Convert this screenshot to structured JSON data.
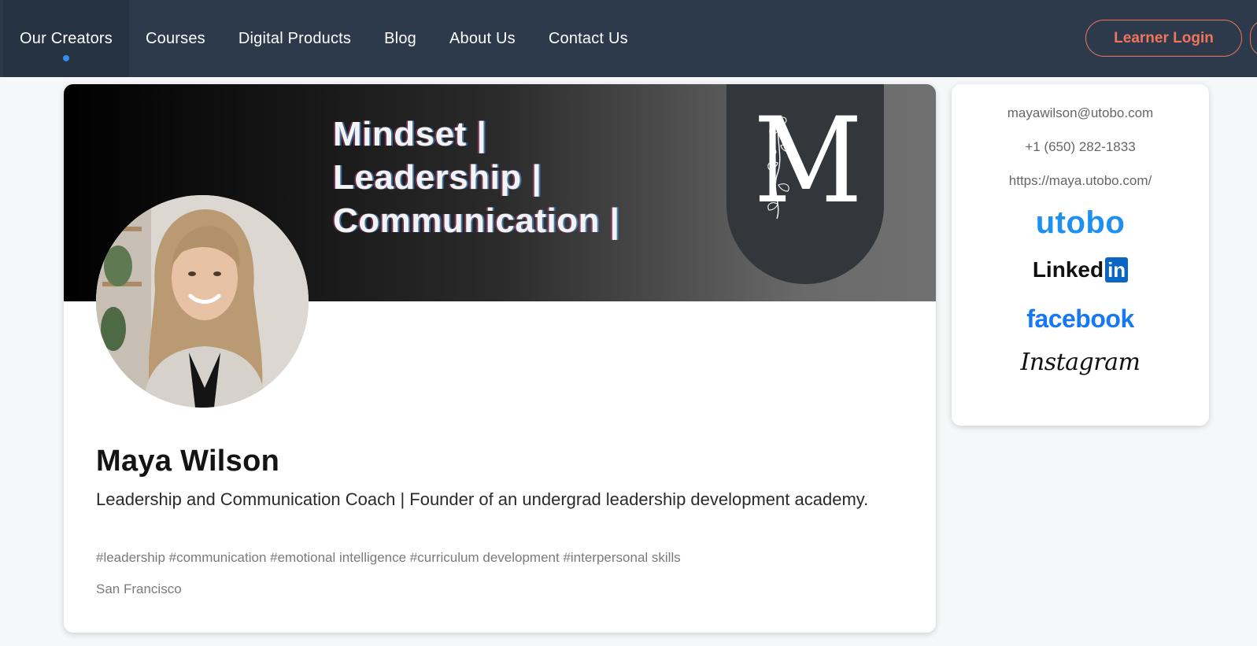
{
  "nav": {
    "items": [
      {
        "label": "Our Creators",
        "active": true
      },
      {
        "label": "Courses"
      },
      {
        "label": "Digital Products"
      },
      {
        "label": "Blog"
      },
      {
        "label": "About Us"
      },
      {
        "label": "Contact Us"
      }
    ],
    "login_label": "Learner Login"
  },
  "banner": {
    "lines": [
      "Mindset |",
      "Leadership |",
      "Communication |"
    ],
    "monogram": "M"
  },
  "profile": {
    "name": "Maya Wilson",
    "bio": "Leadership and Communication Coach | Founder of an undergrad leadership development academy.",
    "tags": "#leadership #communication #emotional intelligence #curriculum development #interpersonal skills",
    "location": "San Francisco"
  },
  "contact": {
    "email": "mayawilson@utobo.com",
    "phone": "+1 (650) 282-1833",
    "website": "https://maya.utobo.com/",
    "links": {
      "utobo": "utobo",
      "linkedin_word": "Linked",
      "linkedin_box": "in",
      "facebook": "facebook",
      "instagram": "Instagram"
    }
  },
  "colors": {
    "nav_bg": "#2c3a4b",
    "accent_blue": "#2f8ff0",
    "login_coral": "#f0745b",
    "page_bg": "#f5f7f9"
  }
}
